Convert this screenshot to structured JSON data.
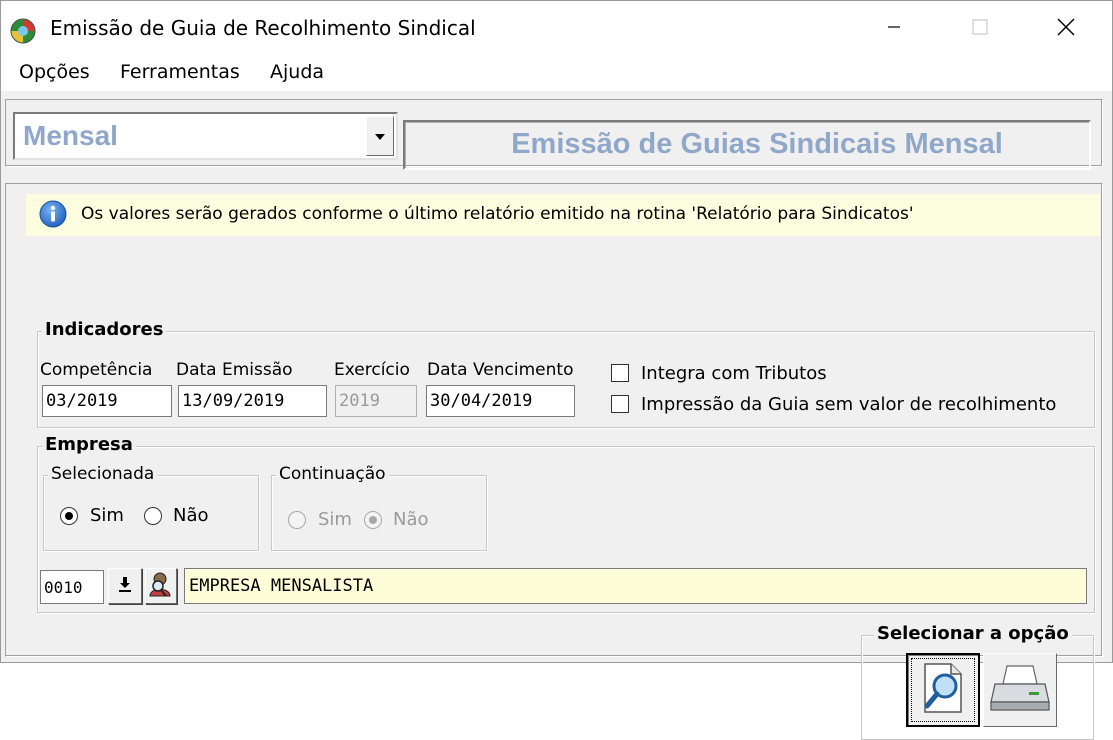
{
  "window": {
    "title": "Emissão de Guia de Recolhimento Sindical",
    "app_icon": "globe-icon",
    "controls": [
      "minimize-icon",
      "maximize-icon",
      "close-icon"
    ]
  },
  "menu": {
    "items": [
      "Opções",
      "Ferramentas",
      "Ajuda"
    ]
  },
  "top": {
    "combo_value": "Mensal",
    "header_title": "Emissão de Guias Sindicais Mensal",
    "accent_color": "#8fa7c9"
  },
  "info": {
    "icon": "info-icon",
    "text": "Os valores serão gerados conforme o último relatório emitido na rotina 'Relatório para Sindicatos'"
  },
  "indicadores": {
    "legend": "Indicadores",
    "competencia_label": "Competência",
    "competencia_value": "03/2019",
    "data_emissao_label": "Data Emissão",
    "data_emissao_value": "13/09/2019",
    "exercicio_label": "Exercício",
    "exercicio_value": "2019",
    "data_vencimento_label": "Data Vencimento",
    "data_vencimento_value": "30/04/2019",
    "integra_label": "Integra com Tributos",
    "integra_checked": false,
    "impressao_label": "Impressão da Guia sem valor de recolhimento",
    "impressao_checked": false
  },
  "empresa": {
    "legend": "Empresa",
    "selecionada": {
      "legend": "Selecionada",
      "sim_label": "Sim",
      "nao_label": "Não",
      "selected": "Sim"
    },
    "continuacao": {
      "legend": "Continuação",
      "sim_label": "Sim",
      "nao_label": "Não",
      "selected": "Não",
      "disabled": true
    },
    "code": "0010",
    "name": "EMPRESA MENSALISTA"
  },
  "actions": {
    "legend": "Selecionar a opção",
    "preview_icon": "magnifier-document-icon",
    "print_icon": "printer-icon"
  }
}
